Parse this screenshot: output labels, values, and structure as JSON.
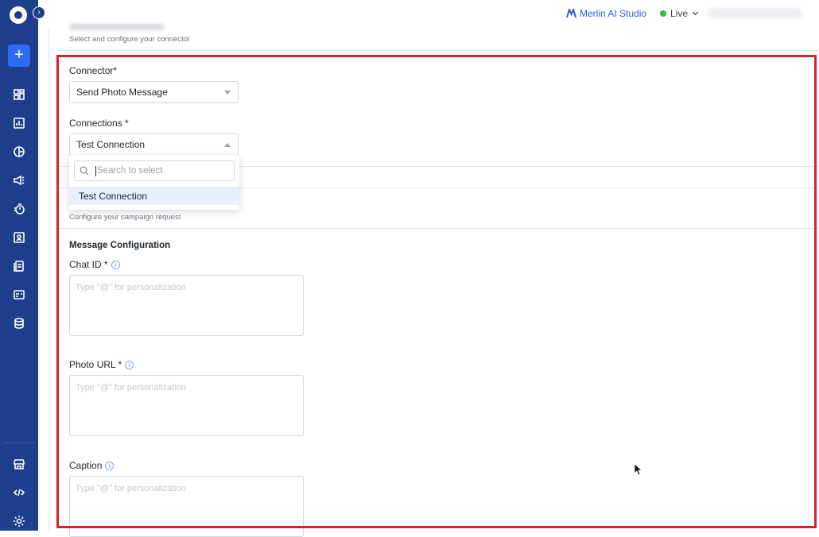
{
  "topbar": {
    "brand": "Merlin AI Studio",
    "env": "Live",
    "live_color": "#2fbf3a"
  },
  "sidebar": {
    "add_label": "+",
    "items": [
      "dashboard-icon",
      "analytics-icon",
      "segments-icon",
      "campaigns-icon",
      "timer-icon",
      "contacts-icon",
      "templates-icon",
      "forms-icon",
      "database-icon",
      "store-icon",
      "code-icon",
      "settings-icon"
    ]
  },
  "connector_section": {
    "caption": "Select and configure your connector"
  },
  "form": {
    "connector_label": "Connector*",
    "connector_value": "Send Photo Message",
    "connections_label": "Connections *",
    "connections_value": "Test Connection",
    "dropdown": {
      "search_placeholder": "Search to select",
      "options": [
        "Test Connection"
      ]
    }
  },
  "request_section": {
    "caption": "Configure your campaign request",
    "title": "Message Configuration"
  },
  "fields": [
    {
      "label": "Chat ID *",
      "placeholder": "Type \"@\" for personalization"
    },
    {
      "label": "Photo URL *",
      "placeholder": "Type \"@\" for personalization"
    },
    {
      "label": "Caption",
      "placeholder": "Type \"@\" for personalization"
    }
  ],
  "colors": {
    "sidebar": "#1f3f8c",
    "accent": "#2e6cf6",
    "highlight_border": "#d9212a"
  }
}
